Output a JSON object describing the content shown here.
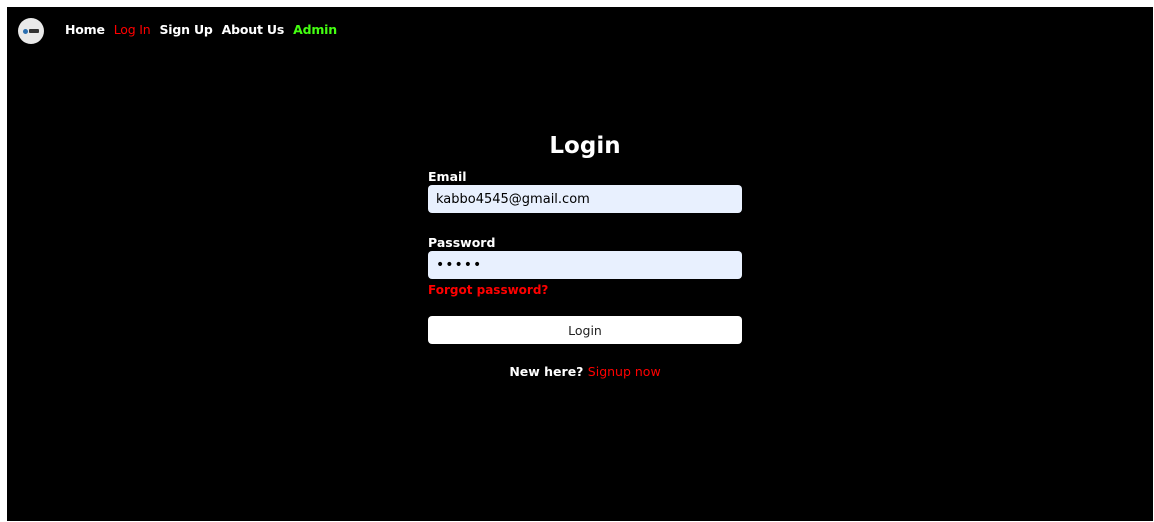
{
  "nav": {
    "logo_icon": "brand-logo-icon",
    "items": [
      {
        "label": "Home",
        "state": "default"
      },
      {
        "label": "Log In",
        "state": "active"
      },
      {
        "label": "Sign Up",
        "state": "default"
      },
      {
        "label": "About Us",
        "state": "default"
      },
      {
        "label": "Admin",
        "state": "admin"
      }
    ]
  },
  "colors": {
    "background": "#000000",
    "accent_red": "#ff0000",
    "admin_green": "#44ff11",
    "input_bg": "#e8f0fe"
  },
  "login": {
    "title": "Login",
    "email_label": "Email",
    "email_value": "kabbo4545@gmail.com",
    "password_label": "Password",
    "password_value": "•••••",
    "forgot_label": "Forgot password?",
    "button_label": "Login",
    "new_here_text": "New here?",
    "signup_label": "Signup now"
  }
}
